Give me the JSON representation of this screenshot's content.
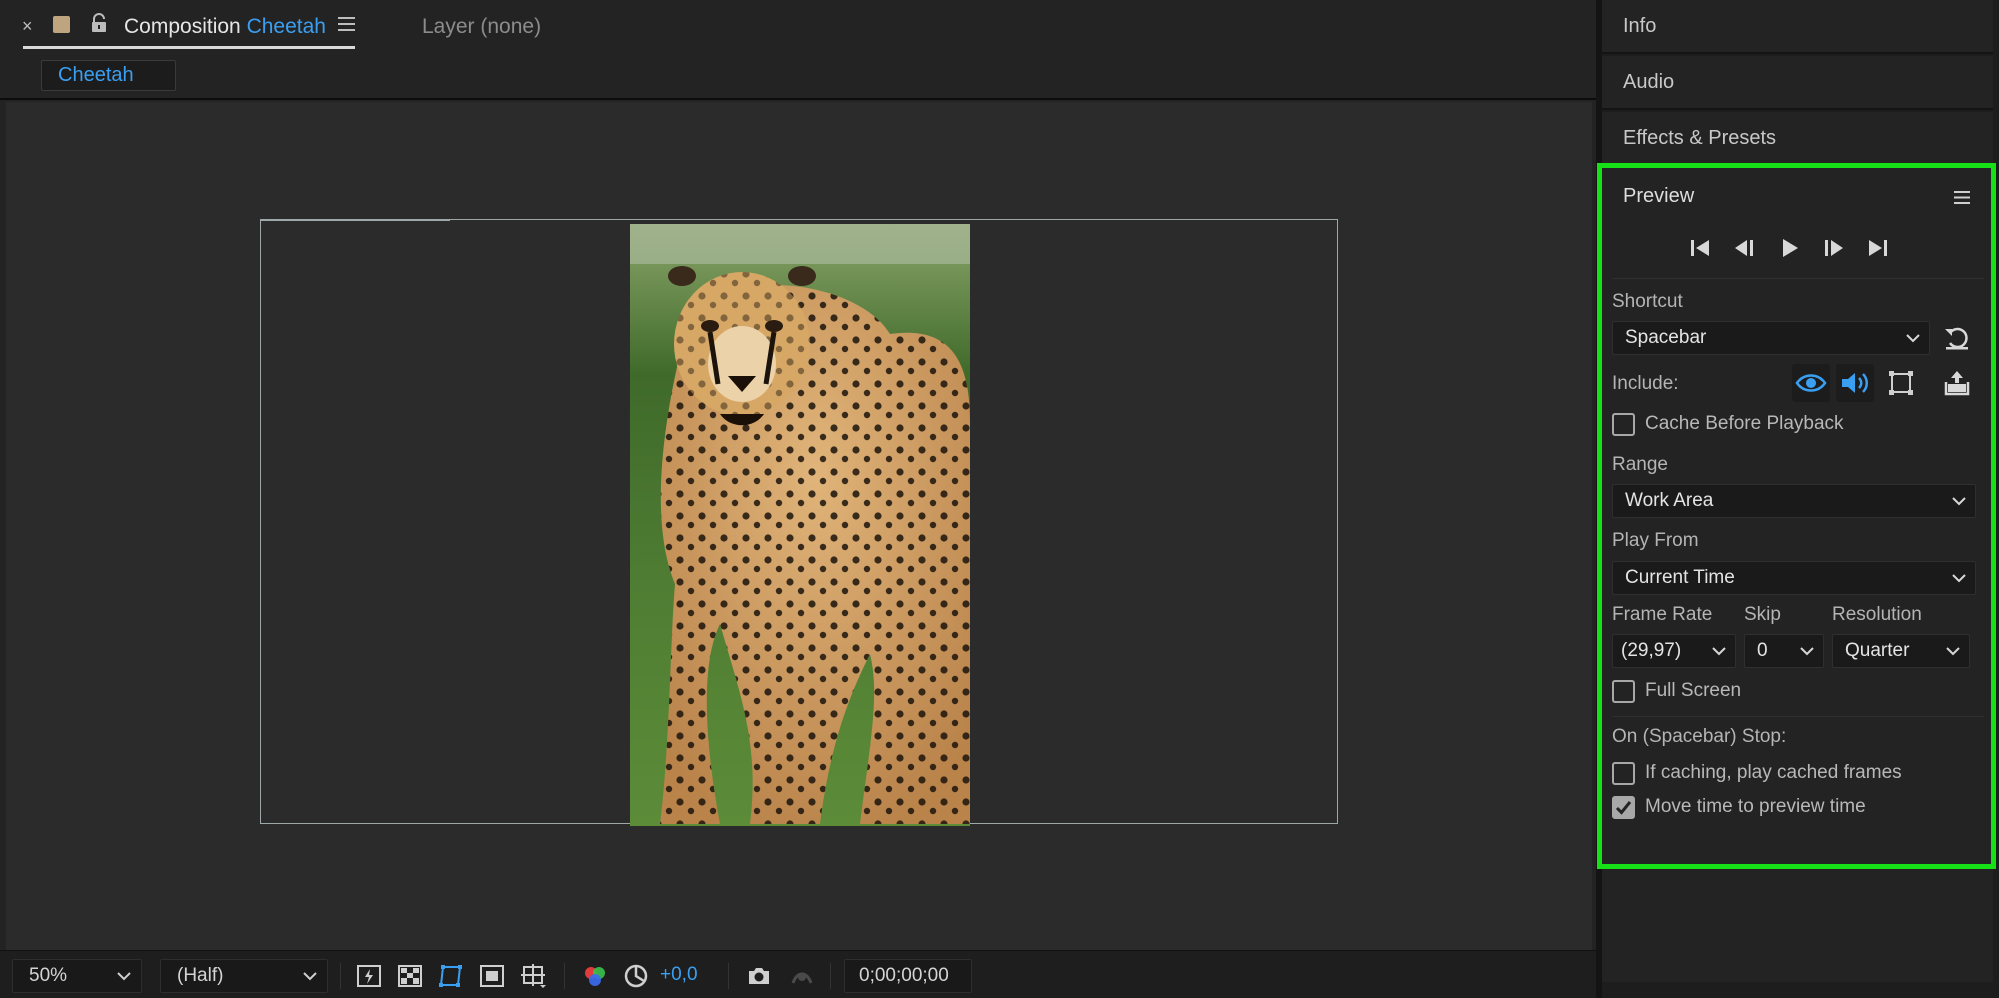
{
  "composition_tab": {
    "close_glyph": "×",
    "label_prefix": "Composition",
    "comp_name": "Cheetah",
    "layer_tab": "Layer (none)"
  },
  "comp_selector": {
    "label": "Cheetah"
  },
  "viewer_bottom_bar": {
    "zoom": "50%",
    "resolution": "(Half)",
    "exposure_offset": "+0,0",
    "timecode": "0;00;00;00"
  },
  "right_panels": {
    "info": "Info",
    "audio": "Audio",
    "effects": "Effects & Presets"
  },
  "preview": {
    "title": "Preview",
    "shortcut_label": "Shortcut",
    "shortcut_value": "Spacebar",
    "include_label": "Include:",
    "cache_before_playback": "Cache Before Playback",
    "range_label": "Range",
    "range_value": "Work Area",
    "play_from_label": "Play From",
    "play_from_value": "Current Time",
    "frame_rate_label": "Frame Rate",
    "frame_rate_value": "(29,97)",
    "skip_label": "Skip",
    "skip_value": "0",
    "resolution_label": "Resolution",
    "resolution_value": "Quarter",
    "full_screen": "Full Screen",
    "on_stop_label": "On (Spacebar) Stop:",
    "if_caching": "If caching, play cached frames",
    "move_time": "Move time to preview time",
    "states": {
      "cache_before_playback": false,
      "full_screen": false,
      "if_caching": false,
      "move_time": true
    }
  },
  "colors": {
    "accent_blue": "#3b9ff1",
    "highlight_green": "#16e016",
    "comp_swatch": "#bfa57f"
  }
}
